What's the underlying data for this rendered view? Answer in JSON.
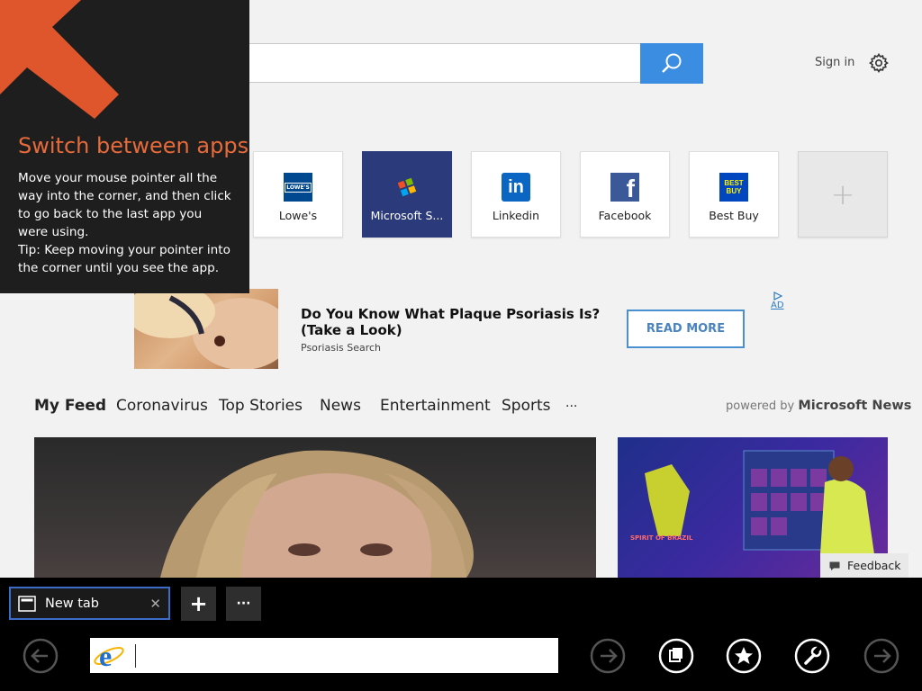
{
  "header": {
    "signin_label": "Sign in"
  },
  "tiles": [
    {
      "label": "Lowe's",
      "logo_text": "LOWE'S",
      "logo_color": "#004990"
    },
    {
      "label": "Microsoft S...",
      "logo_color": "#5c6bd6"
    },
    {
      "label": "Linkedin",
      "logo_text": "in",
      "logo_color": "#0a66c2"
    },
    {
      "label": "Facebook",
      "logo_text": "f",
      "logo_color": "#3b5998"
    },
    {
      "label": "Best Buy",
      "logo_text": "BEST BUY",
      "logo_color": "#0046be"
    }
  ],
  "add_tile": {
    "symbol": "+"
  },
  "ad": {
    "title": "Do You Know What Plaque Psoriasis Is? (Take a Look)",
    "source": "Psoriasis Search",
    "button": "READ MORE",
    "badge": "AD"
  },
  "feed": {
    "tabs": [
      "My Feed",
      "Coronavirus",
      "Top Stories",
      "News",
      "Entertainment",
      "Sports",
      "···"
    ],
    "powered_prefix": "powered by",
    "powered_brand": "Microsoft News",
    "side_card_caption": "SPIRIT OF BRAZIL"
  },
  "feedback_label": "Feedback",
  "overlay": {
    "title": "Switch between apps",
    "body": "Move your mouse pointer all the way into the corner, and then click to go back to the last app you were using.",
    "tip": "Tip: Keep moving your pointer into the corner until you see the app."
  },
  "bottom": {
    "tab_title": "New tab",
    "tab_close": "✕",
    "new_tab_symbol": "+",
    "more_symbol": "···",
    "address_value": ""
  },
  "colors": {
    "accent": "#3a8de0",
    "overlay_title": "#e66a3a",
    "selected_tile": "#2b3a7a"
  }
}
